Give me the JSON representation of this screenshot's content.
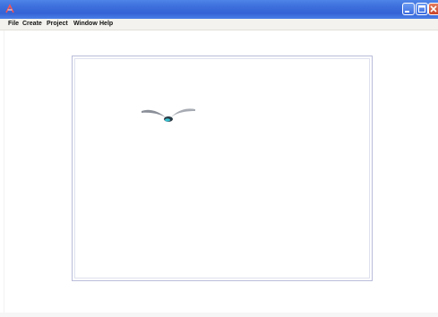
{
  "window": {
    "title": "",
    "controls": [
      "minimize-icon",
      "maximize-icon",
      "close-icon"
    ],
    "titlebar_color": "#3d6fdc"
  },
  "menubar": {
    "items": [
      "File",
      "Create",
      "Project",
      "Window",
      "Help"
    ]
  },
  "canvas": {
    "sprite": "bird-icon",
    "border_color": "#b9bdd9"
  }
}
